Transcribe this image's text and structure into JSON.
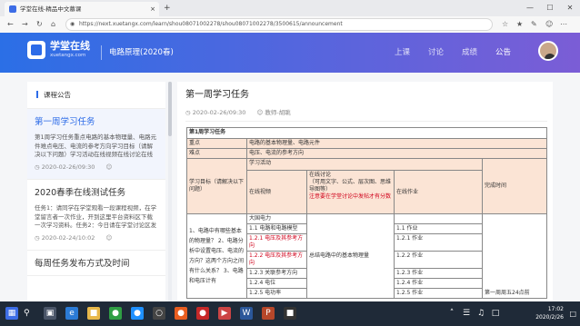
{
  "browser": {
    "tab_title": "学堂在线-精品中文慕课",
    "url": "https://next.xuetangx.com/learn/shou08071002278/shou08071002278/3500615/announcement",
    "new_tab": "+",
    "tab_close": "×"
  },
  "header": {
    "logo_text": "学堂在线",
    "logo_sub": "xuetangx.com",
    "course_title": "电路原理(2020春)",
    "nav": [
      {
        "label": "上课"
      },
      {
        "label": "讨论"
      },
      {
        "label": "成绩"
      },
      {
        "label": "公告"
      }
    ]
  },
  "sidebar": {
    "title": "课程公告",
    "items": [
      {
        "title": "第一周学习任务",
        "excerpt": "第1周学习任务重点电路的基本物理量、电路元件难点电压、电流的参考方向学习目标（请解决以下问题）学习活动在线视频在线讨论在线",
        "date": "2020-02-26/09:30"
      },
      {
        "title": "2020春季在线测试任务",
        "excerpt": "任务1：请同学在学堂观看一段课程视频，在学堂留言者一次作业，开到这里平台资料区下载一次学习资料。任务2：今日请在学堂讨论区发贴",
        "date": "2020-02-24/10:02"
      },
      {
        "title": "每周任务发布方式及时间",
        "excerpt": "",
        "date": ""
      }
    ]
  },
  "article": {
    "title": "第一周学习任务",
    "date": "2020-02-26/09:30",
    "author": "教师-胡眺",
    "table": {
      "week_title": "第1周学习任务",
      "focus_label": "重点",
      "focus_value": "电路的基本物理量、电路元件",
      "difficulty_label": "难点",
      "difficulty_value": "电压、电流的参考方向",
      "goal_header": "学习目标（请解决以下问题）",
      "activity_header": "学习活动",
      "video_header": "在线视频",
      "discuss_header": "在线讨论",
      "discuss_sub": "（可用文字、公式、层次图、思维导图等）",
      "discuss_note": "注意要在学堂讨论中发帖才有分数",
      "homework_header": "在线作业",
      "time_header": "完成时间",
      "questions": "1、电路中有哪些基本的物理量？ 2、电路分析中设置电压、电流的方向？这两个方向之间有什么关系？ 3、电路和电压计有",
      "videos": [
        "大国电力",
        "1.1 电路和电路模型",
        "1.2.1 电压及其参考方向",
        "1.2.2 电压及其参考方向",
        "1.2.3 关联参考方向",
        "1.2.4 电位",
        "1.2.5 电功率"
      ],
      "discuss_topic": "总结电路中的基本物理量",
      "homework": [
        "1.1 作业",
        "1.2.1 作业",
        "1.2.2 作业",
        "1.2.3 作业",
        "1.2.4 作业",
        "1.2.5 作业"
      ],
      "deadline": "第一周周五24点前"
    }
  },
  "taskbar": {
    "time": "17:02",
    "date": "2020/2/26"
  },
  "colors": {
    "brand_blue": "#2d6ce8",
    "header_gradient_end": "#7b5dd6",
    "table_highlight": "#fbe4d5",
    "emphasis_red": "#d0021b"
  }
}
